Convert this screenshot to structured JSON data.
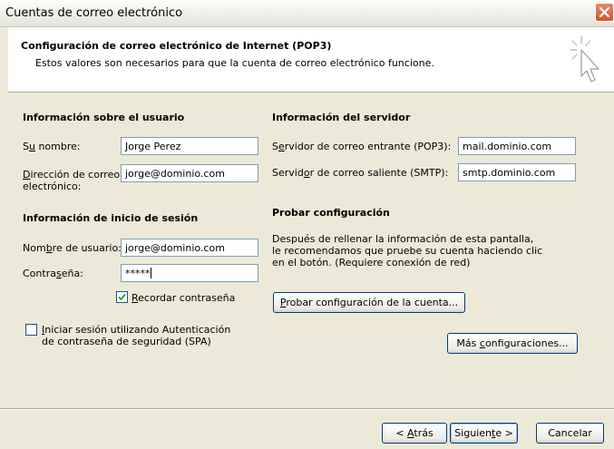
{
  "window": {
    "title": "Cuentas de correo electrónico"
  },
  "header": {
    "title": "Configuración de correo electrónico de Internet (POP3)",
    "subtitle": "Estos valores son necesarios para que la cuenta de correo electrónico funcione.",
    "icon": "pointer-cursor-icon"
  },
  "user_info": {
    "section_title": "Información sobre el usuario",
    "name_label_pre": "S",
    "name_label_key": "u",
    "name_label_post": " nombre:",
    "name_value": "Jorge Perez",
    "email_label_key": "D",
    "email_label_line1": "irección de correo",
    "email_label_line2": "electrónico:",
    "email_value": "jorge@dominio.com"
  },
  "login_info": {
    "section_title": "Información de inicio de sesión",
    "username_label_pre": "Nom",
    "username_label_key": "b",
    "username_label_post": "re de usuario:",
    "username_value": "jorge@dominio.com",
    "password_label_pre": "Contra",
    "password_label_key": "s",
    "password_label_post": "eña:",
    "password_value": "*****",
    "remember_key": "R",
    "remember_label": "ecordar contraseña",
    "remember_checked": true,
    "spa_key": "I",
    "spa_line1": "niciar sesión utilizando Autenticación",
    "spa_line2": "de contraseña de seguridad (SPA)",
    "spa_checked": false
  },
  "server_info": {
    "section_title": "Información del servidor",
    "incoming_label_pre": "S",
    "incoming_label_key": "e",
    "incoming_label_post": "rvidor de correo entrante (POP3):",
    "incoming_value": "mail.dominio.com",
    "outgoing_label_pre": "Servid",
    "outgoing_label_key": "o",
    "outgoing_label_post": "r de correo saliente (SMTP):",
    "outgoing_value": "smtp.dominio.com"
  },
  "test": {
    "section_title": "Probar configuración",
    "description_line1": "Después de rellenar la información de esta pantalla,",
    "description_line2": "le recomendamos que pruebe su cuenta haciendo clic",
    "description_line3": "en el botón. (Requiere conexión de red)",
    "test_button_key": "P",
    "test_button_label": "robar configuración de la cuenta...",
    "more_pre": "Más ",
    "more_key": "c",
    "more_post": "onfiguraciones..."
  },
  "footer": {
    "back_pre": "< ",
    "back_key": "A",
    "back_post": "trás",
    "next_pre": "Siguien",
    "next_key": "t",
    "next_post": "e >",
    "cancel_label": "Cancelar"
  },
  "colors": {
    "dialog_bg": "#ece9d8",
    "field_border": "#7f9db9",
    "button_border": "#003c74",
    "close_button": "#d3542f",
    "checkmark": "#21a121"
  }
}
